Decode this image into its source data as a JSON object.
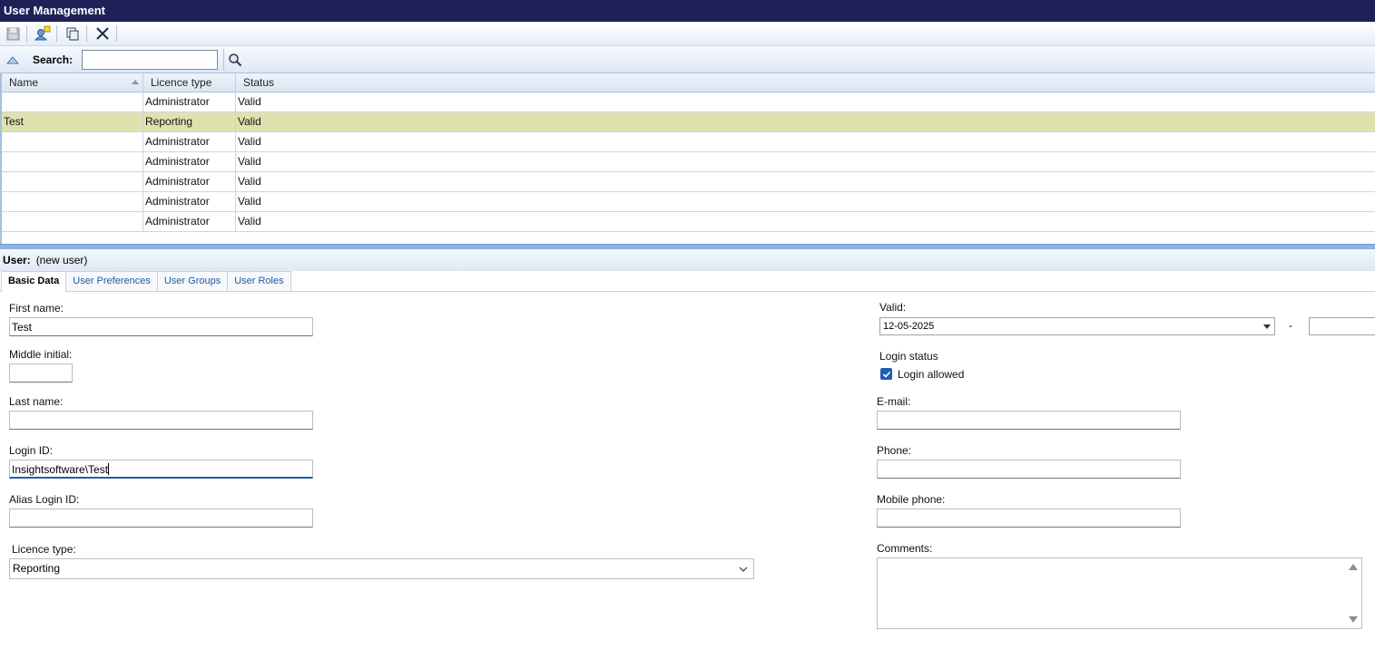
{
  "window": {
    "title": "User Management"
  },
  "toolbar": {
    "buttons": [
      {
        "name": "save-button",
        "icon": "disk-icon"
      },
      {
        "name": "new-user-button",
        "icon": "new-user-icon"
      },
      {
        "name": "copy-button",
        "icon": "copy-icon"
      },
      {
        "name": "delete-button",
        "icon": "close-icon"
      }
    ]
  },
  "search": {
    "label": "Search:",
    "value": "",
    "placeholder": ""
  },
  "grid": {
    "columns": [
      "Name",
      "Licence type",
      "Status"
    ],
    "sort_column": "Name",
    "rows": [
      {
        "name": "",
        "licence": "Administrator",
        "status": "Valid",
        "selected": false
      },
      {
        "name": "Test",
        "licence": "Reporting",
        "status": "Valid",
        "selected": true
      },
      {
        "name": "",
        "licence": "Administrator",
        "status": "Valid",
        "selected": false
      },
      {
        "name": "",
        "licence": "Administrator",
        "status": "Valid",
        "selected": false
      },
      {
        "name": "",
        "licence": "Administrator",
        "status": "Valid",
        "selected": false
      },
      {
        "name": "",
        "licence": "Administrator",
        "status": "Valid",
        "selected": false
      },
      {
        "name": "",
        "licence": "Administrator",
        "status": "Valid",
        "selected": false
      }
    ],
    "selected_color": "#dfe2ae"
  },
  "detail": {
    "label": "User:",
    "value": "(new user)",
    "tabs": [
      "Basic Data",
      "User Preferences",
      "User Groups",
      "User Roles"
    ],
    "active_tab": "Basic Data"
  },
  "form": {
    "first_name": {
      "label": "First name:",
      "value": "Test"
    },
    "middle_initial": {
      "label": "Middle initial:",
      "value": ""
    },
    "last_name": {
      "label": "Last name:",
      "value": ""
    },
    "login_id": {
      "label": "Login ID:",
      "value": "Insightsoftware\\Test"
    },
    "alias_login_id": {
      "label": "Alias Login ID:",
      "value": ""
    },
    "licence_type": {
      "label": "Licence type:",
      "value": "Reporting"
    },
    "valid": {
      "label": "Valid:",
      "from": "12-05-2025",
      "separator": "-",
      "to": ""
    },
    "login_status": {
      "label": "Login status",
      "checkbox_label": "Login allowed",
      "checked": true
    },
    "email": {
      "label": "E-mail:",
      "value": ""
    },
    "phone": {
      "label": "Phone:",
      "value": ""
    },
    "mobile_phone": {
      "label": "Mobile phone:",
      "value": ""
    },
    "comments": {
      "label": "Comments:",
      "value": ""
    }
  },
  "colors": {
    "titlebar": "#1e2157",
    "accent": "#1e5fb4",
    "splitter": "#8eb3de"
  }
}
